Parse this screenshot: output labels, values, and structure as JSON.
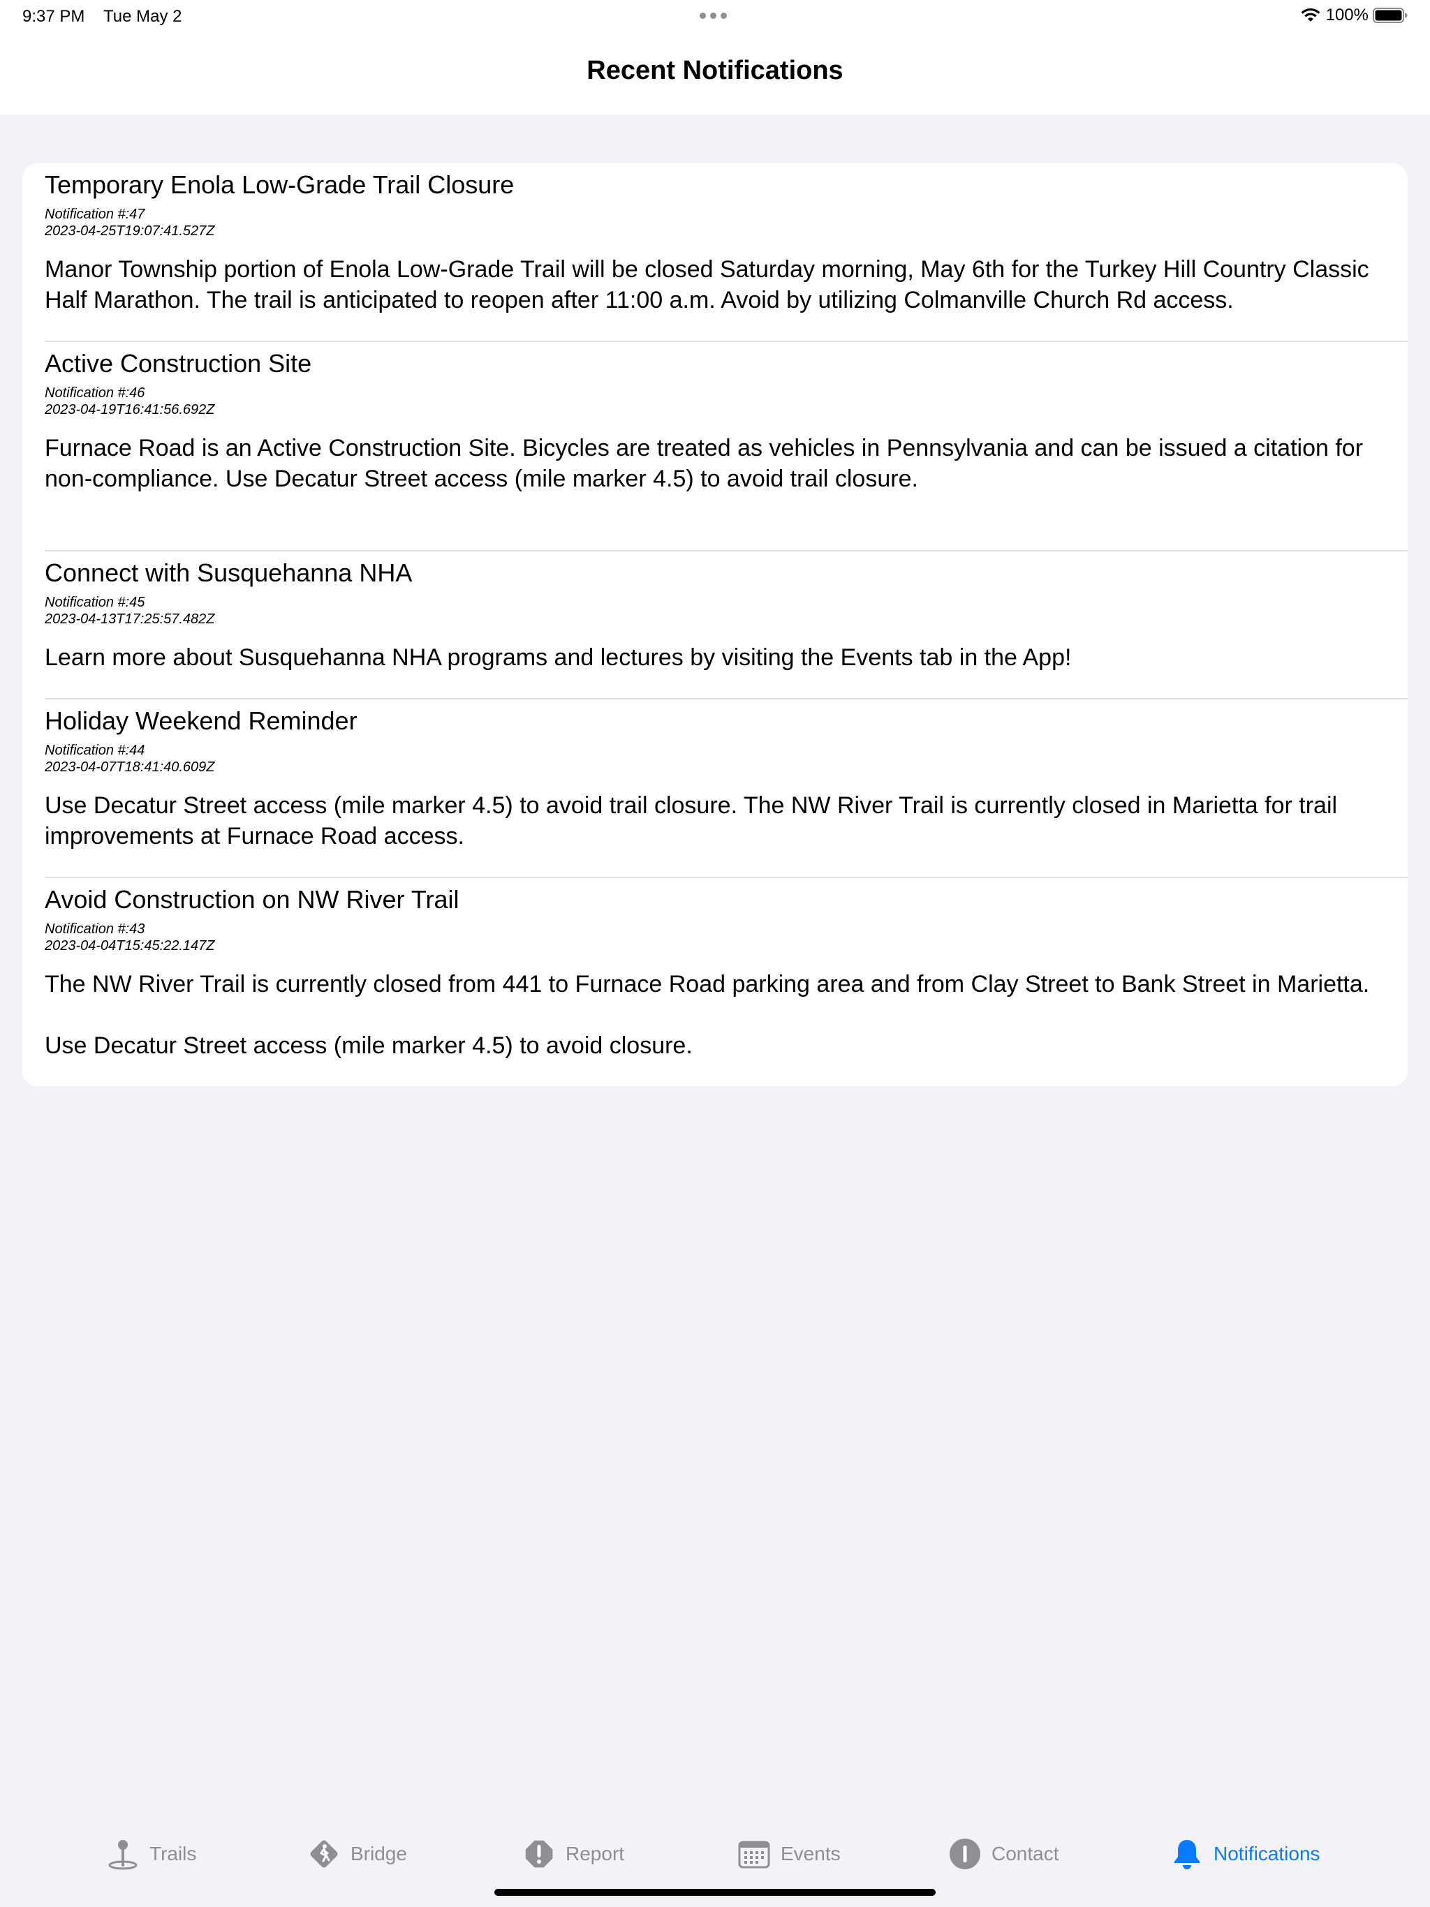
{
  "status_bar": {
    "time": "9:37 PM",
    "date": "Tue May 2",
    "battery": "100%"
  },
  "nav": {
    "title": "Recent Notifications"
  },
  "notifications": [
    {
      "title": "Temporary Enola Low-Grade Trail Closure",
      "number": "Notification #:47",
      "date": "2023-04-25T19:07:41.527Z",
      "body": "Manor Township portion of Enola Low-Grade Trail will be closed Saturday morning, May 6th for the Turkey Hill Country Classic Half Marathon. The trail is anticipated to reopen after 11:00 a.m. Avoid by utilizing Colmanville Church Rd access."
    },
    {
      "title": "Active Construction Site",
      "number": "Notification #:46",
      "date": "2023-04-19T16:41:56.692Z",
      "body": "Furnace Road is an Active Construction Site. Bicycles are treated as vehicles in Pennsylvania and can be issued a citation for non-compliance. Use Decatur Street access (mile marker 4.5) to avoid trail closure."
    },
    {
      "title": "Connect with Susquehanna NHA",
      "number": "Notification #:45",
      "date": "2023-04-13T17:25:57.482Z",
      "body": "Learn more about Susquehanna NHA programs and lectures by visiting the Events tab in the App!"
    },
    {
      "title": "Holiday Weekend Reminder",
      "number": "Notification #:44",
      "date": "2023-04-07T18:41:40.609Z",
      "body": "Use Decatur Street access (mile marker 4.5) to avoid trail closure. The NW River Trail is currently closed in Marietta for trail improvements at Furnace Road access."
    },
    {
      "title": "Avoid Construction on NW River Trail",
      "number": "Notification #:43",
      "date": "2023-04-04T15:45:22.147Z",
      "body": "The NW River Trail is currently closed from 441 to Furnace Road parking area and from Clay Street to Bank Street in Marietta.\n\nUse Decatur Street access (mile marker 4.5) to avoid closure."
    }
  ],
  "tabs": [
    {
      "label": "Trails",
      "icon": "trail-pin-icon"
    },
    {
      "label": "Bridge",
      "icon": "pedestrian-sign-icon"
    },
    {
      "label": "Report",
      "icon": "exclamation-octagon-icon"
    },
    {
      "label": "Events",
      "icon": "calendar-icon"
    },
    {
      "label": "Contact",
      "icon": "info-circle-icon"
    },
    {
      "label": "Notifications",
      "icon": "bell-icon",
      "active": true
    }
  ],
  "colors": {
    "accent": "#0a7aff",
    "tab_inactive": "#8e8e93",
    "background": "#f2f2f7"
  }
}
